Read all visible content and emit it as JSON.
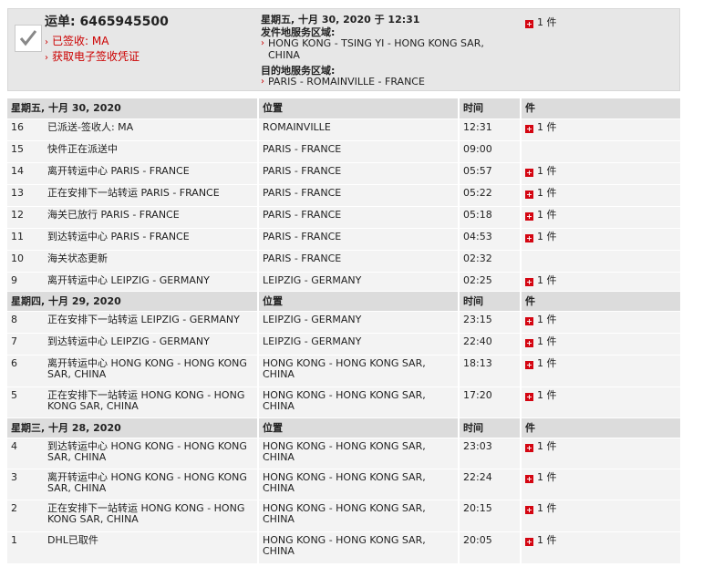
{
  "summary": {
    "waybill": "运单: 6465945500",
    "status": "已签收: MA",
    "pod_link": "获取电子签收凭证",
    "date": "星期五, 十月 30, 2020 于 12:31",
    "origin_label": "发件地服务区域:",
    "origin_value": "HONG KONG - TSING YI - HONG KONG SAR, CHINA",
    "dest_label": "目的地服务区域:",
    "dest_value": "PARIS - ROMAINVILLE - FRANCE",
    "pieces": "1 件"
  },
  "groups": [
    {
      "header": {
        "date": "星期五, 十月 30, 2020",
        "loc": "位置",
        "time": "时间",
        "pcs": "件"
      },
      "rows": [
        {
          "n": "16",
          "desc": "已派送-签收人: MA",
          "loc": "ROMAINVILLE",
          "time": "12:31",
          "pcs": "1 件"
        },
        {
          "n": "15",
          "desc": "快件正在派送中",
          "loc": "PARIS - FRANCE",
          "time": "09:00",
          "pcs": ""
        },
        {
          "n": "14",
          "desc": "离开转运中心 PARIS - FRANCE",
          "loc": "PARIS - FRANCE",
          "time": "05:57",
          "pcs": "1 件"
        },
        {
          "n": "13",
          "desc": "正在安排下一站转运 PARIS - FRANCE",
          "loc": "PARIS - FRANCE",
          "time": "05:22",
          "pcs": "1 件"
        },
        {
          "n": "12",
          "desc": "海关已放行 PARIS - FRANCE",
          "loc": "PARIS - FRANCE",
          "time": "05:18",
          "pcs": "1 件"
        },
        {
          "n": "11",
          "desc": "到达转运中心 PARIS - FRANCE",
          "loc": "PARIS - FRANCE",
          "time": "04:53",
          "pcs": "1 件"
        },
        {
          "n": "10",
          "desc": "海关状态更新",
          "loc": "PARIS - FRANCE",
          "time": "02:32",
          "pcs": ""
        },
        {
          "n": "9",
          "desc": "离开转运中心 LEIPZIG - GERMANY",
          "loc": "LEIPZIG - GERMANY",
          "time": "02:25",
          "pcs": "1 件"
        }
      ]
    },
    {
      "header": {
        "date": "星期四, 十月 29, 2020",
        "loc": "位置",
        "time": "时间",
        "pcs": "件"
      },
      "rows": [
        {
          "n": "8",
          "desc": "正在安排下一站转运 LEIPZIG - GERMANY",
          "loc": "LEIPZIG - GERMANY",
          "time": "23:15",
          "pcs": "1 件"
        },
        {
          "n": "7",
          "desc": "到达转运中心 LEIPZIG - GERMANY",
          "loc": "LEIPZIG - GERMANY",
          "time": "22:40",
          "pcs": "1 件"
        },
        {
          "n": "6",
          "desc": "离开转运中心 HONG KONG - HONG KONG SAR, CHINA",
          "loc": "HONG KONG - HONG KONG SAR, CHINA",
          "time": "18:13",
          "pcs": "1 件"
        },
        {
          "n": "5",
          "desc": "正在安排下一站转运 HONG KONG - HONG KONG SAR, CHINA",
          "loc": "HONG KONG - HONG KONG SAR, CHINA",
          "time": "17:20",
          "pcs": "1 件"
        }
      ]
    },
    {
      "header": {
        "date": "星期三, 十月 28, 2020",
        "loc": "位置",
        "time": "时间",
        "pcs": "件"
      },
      "rows": [
        {
          "n": "4",
          "desc": "到达转运中心 HONG KONG - HONG KONG SAR, CHINA",
          "loc": "HONG KONG - HONG KONG SAR, CHINA",
          "time": "23:03",
          "pcs": "1 件"
        },
        {
          "n": "3",
          "desc": "离开转运中心 HONG KONG - HONG KONG SAR, CHINA",
          "loc": "HONG KONG - HONG KONG SAR, CHINA",
          "time": "22:24",
          "pcs": "1 件"
        },
        {
          "n": "2",
          "desc": "正在安排下一站转运 HONG KONG - HONG KONG SAR, CHINA",
          "loc": "HONG KONG - HONG KONG SAR, CHINA",
          "time": "20:15",
          "pcs": "1 件"
        },
        {
          "n": "1",
          "desc": "DHL已取件",
          "loc": "HONG KONG - HONG KONG SAR, CHINA",
          "time": "20:05",
          "pcs": "1 件"
        }
      ]
    }
  ],
  "colors": {
    "accent": "#cc0000",
    "header_bg": "#dcdcdc",
    "row_bg": "#f3f3f3",
    "summary_bg": "#e7e7e7"
  }
}
